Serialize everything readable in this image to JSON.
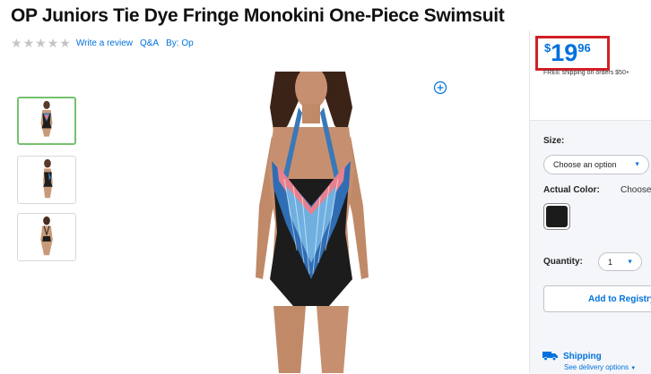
{
  "product": {
    "title": "OP Juniors Tie Dye Fringe Monokini One-Piece Swimsuit",
    "rating_stars": 0,
    "write_review": "Write a review",
    "qa": "Q&A",
    "brand_by": "By: Op"
  },
  "gallery": {
    "thumbnails": [
      {
        "view": "front",
        "selected": true
      },
      {
        "view": "side",
        "selected": false
      },
      {
        "view": "back",
        "selected": false
      }
    ],
    "zoom_icon": "zoom-plus-icon"
  },
  "buybox": {
    "price": {
      "currency": "$",
      "dollars": "19",
      "cents": "96"
    },
    "shipping_note": "FREE shipping on orders $50+",
    "size_label": "Size:",
    "size_select": "Choose an option",
    "color_label": "Actual Color:",
    "color_value": "Choose",
    "quantity_label": "Quantity:",
    "quantity_value": "1",
    "registry_button": "Add to Registry",
    "shipping_title": "Shipping",
    "delivery_link": "See delivery options"
  },
  "colors": {
    "accent": "#0071dc",
    "highlight": "#d21f26",
    "selected_thumb": "#74c16d",
    "swatch": "#1b1b1b"
  }
}
